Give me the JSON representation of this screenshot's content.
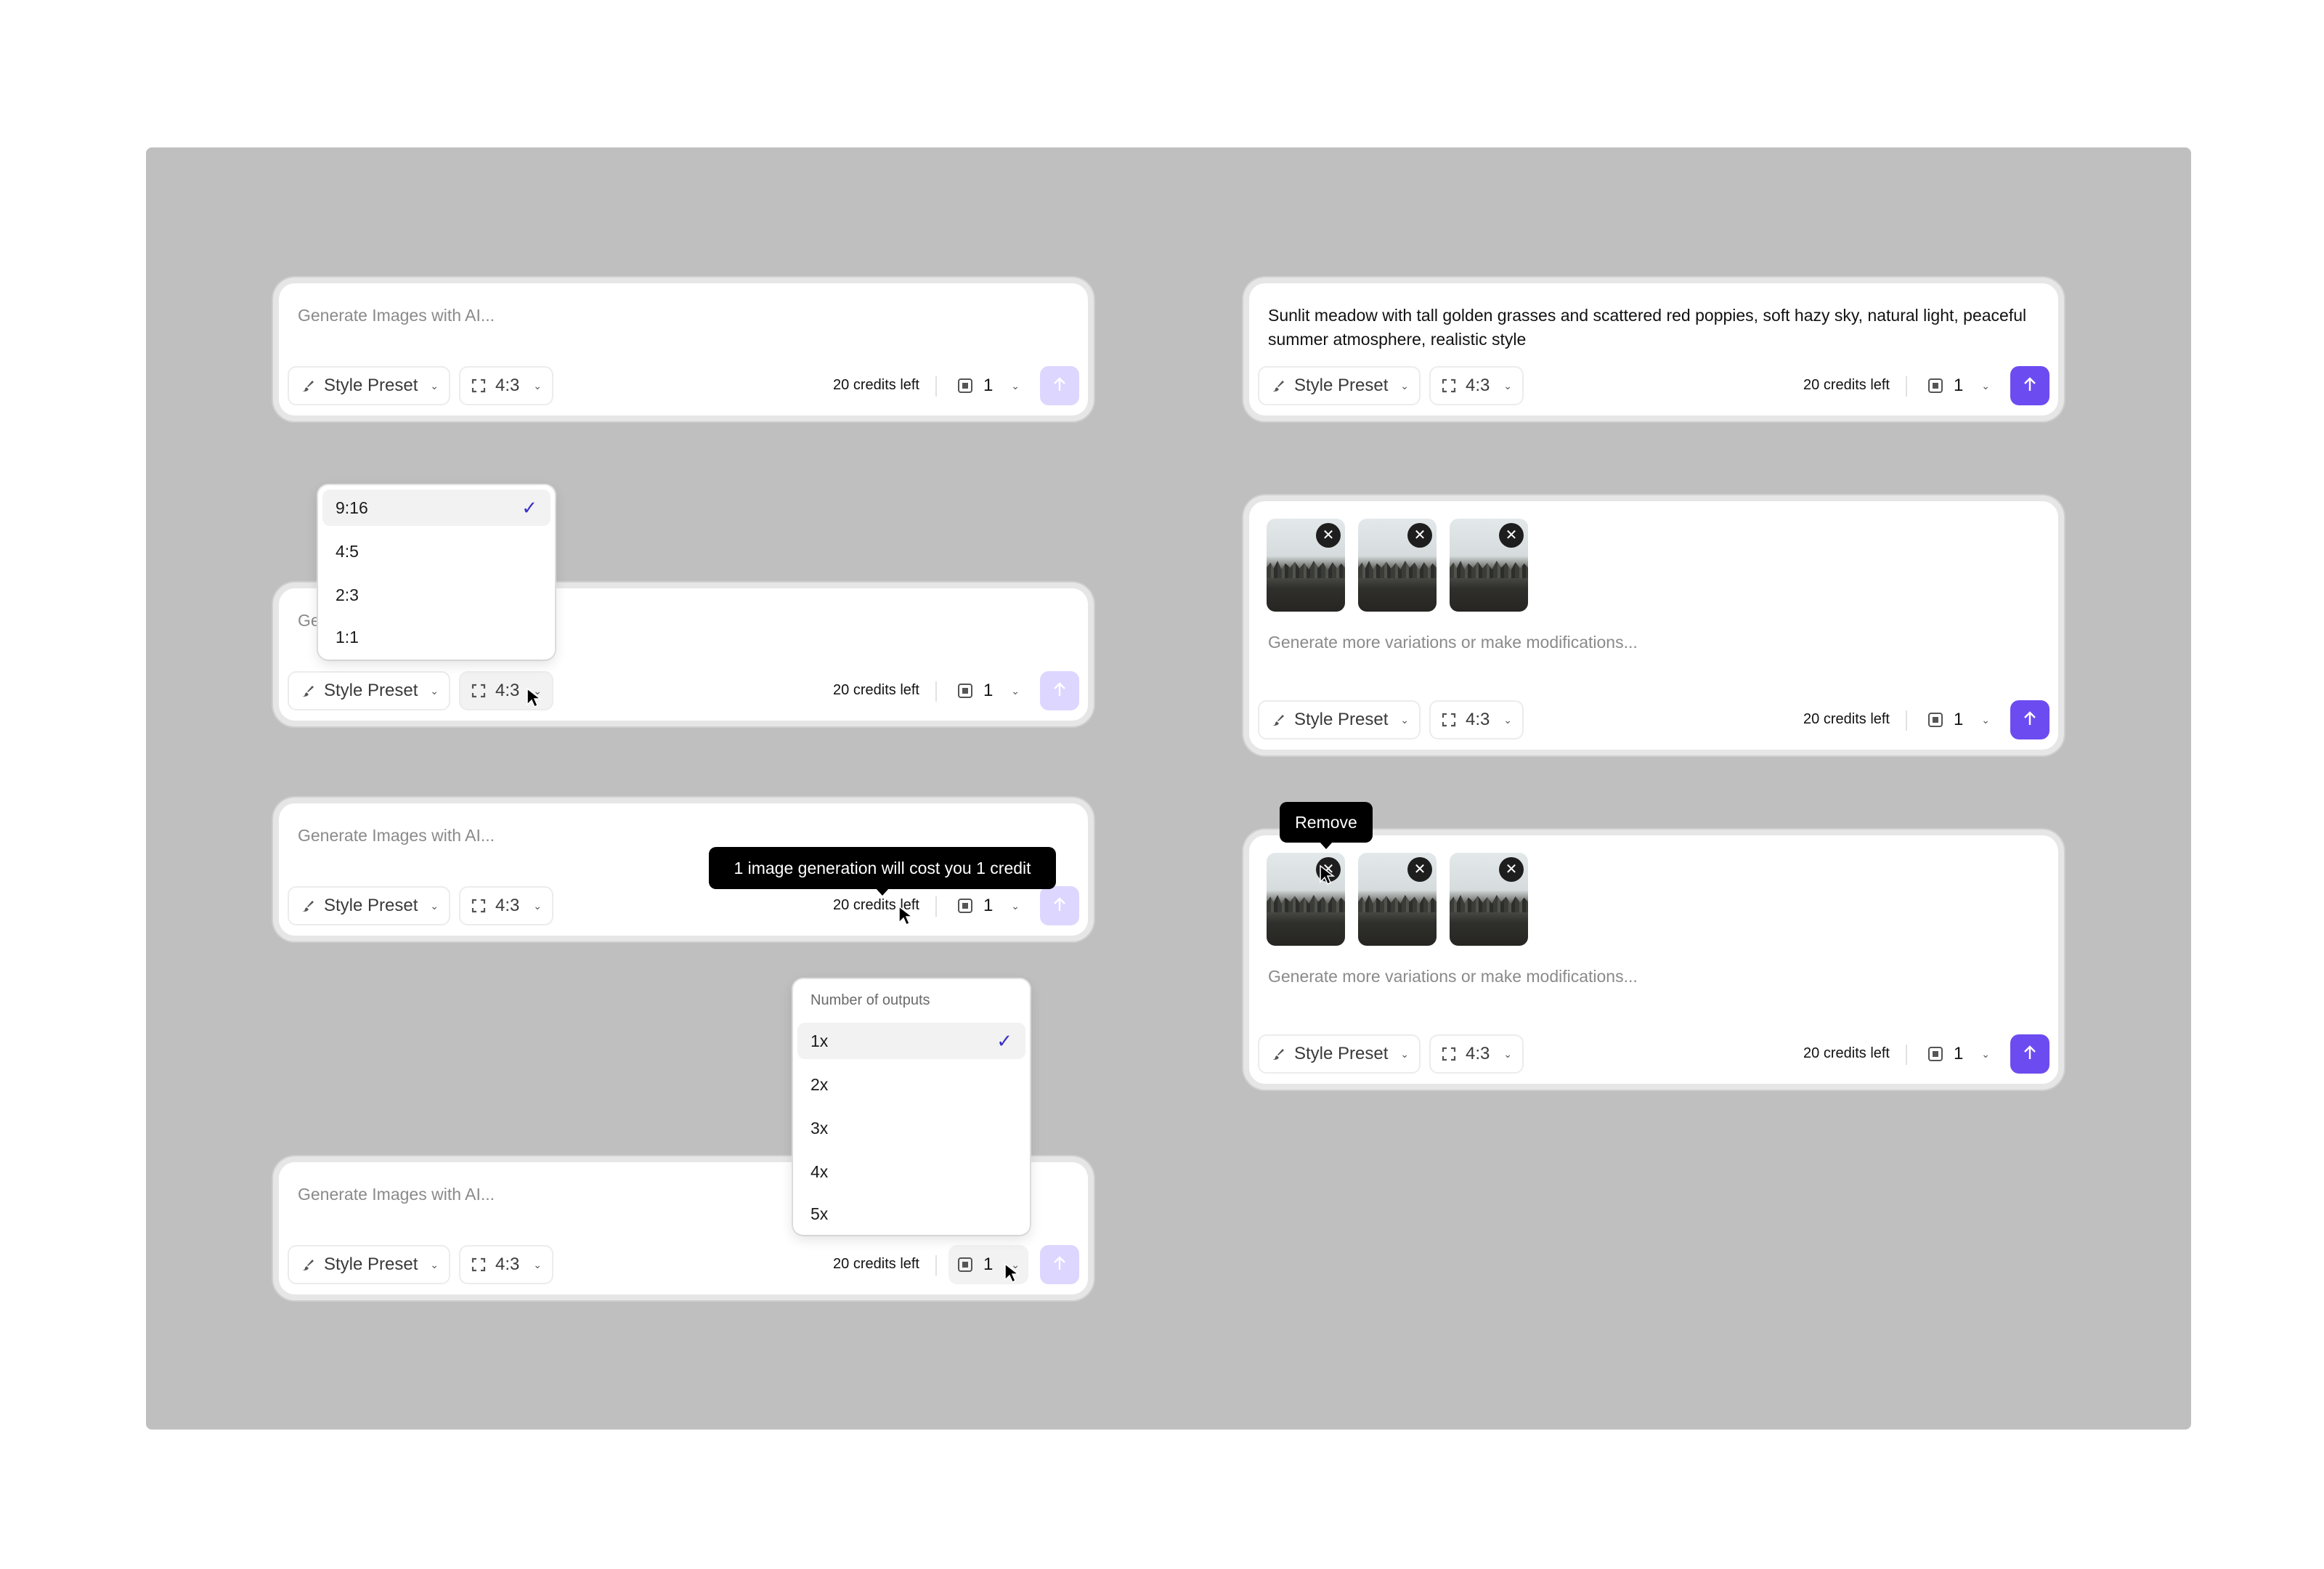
{
  "toolbar": {
    "style_preset_label": "Style Preset",
    "aspect_ratio_value": "4:3",
    "credits_text": "20 credits left",
    "outputs_value": "1"
  },
  "cards": {
    "placeholder_generate": "Generate Images with AI...",
    "placeholder_variations": "Generate more variations or make modifications...",
    "filled_prompt": "Sunlit meadow with tall golden grasses and scattered red poppies, soft hazy sky, natural light, peaceful summer atmosphere, realistic style"
  },
  "aspect_dropdown": {
    "options": [
      "9:16",
      "4:5",
      "2:3",
      "1:1"
    ],
    "selected": "9:16"
  },
  "outputs_dropdown": {
    "header": "Number of outputs",
    "options": [
      "1x",
      "2x",
      "3x",
      "4x",
      "5x"
    ],
    "selected": "1x"
  },
  "tooltips": {
    "credit_cost": "1 image generation will cost you 1 credit",
    "remove": "Remove"
  },
  "colors": {
    "accent": "#6c4cf0",
    "accent_disabled": "#ddd6ff",
    "check": "#3b30c8",
    "backdrop": "#bfbfbf"
  },
  "icons": {
    "style": "brush-icon",
    "ratio": "expand-icon",
    "outputs": "image-icon",
    "send": "arrow-up-icon",
    "remove": "close-icon"
  }
}
